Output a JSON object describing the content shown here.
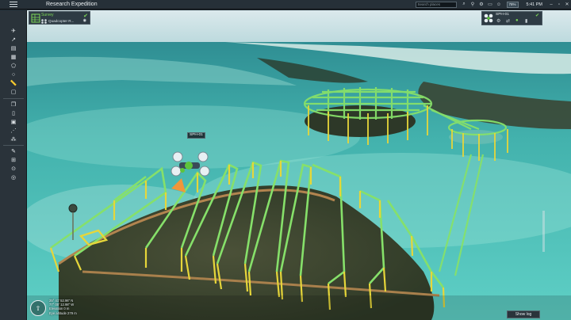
{
  "app": {
    "title": "Research Expedition",
    "search_placeholder": "Search places",
    "battery": "78%",
    "time": "5:41 PM"
  },
  "survey_panel": {
    "title": "Survey",
    "vehicle_name": "Quadcopter R..."
  },
  "vehicle_panel": {
    "name": "SPH-01"
  },
  "map": {
    "drone_label": "SPH-01",
    "latitude": "25° 41' 52.96\" N",
    "longitude": "77° 05' 12.98\" W",
    "elevation": "Elevation 0 m",
    "eye_altitude": "Eye altitude 279 m"
  },
  "footer": {
    "show_log": "Show log"
  },
  "colors": {
    "path_green": "#86e06a",
    "pole_yellow": "#e6d63a",
    "water": "#3fb6b0",
    "land": "#3f4733"
  }
}
